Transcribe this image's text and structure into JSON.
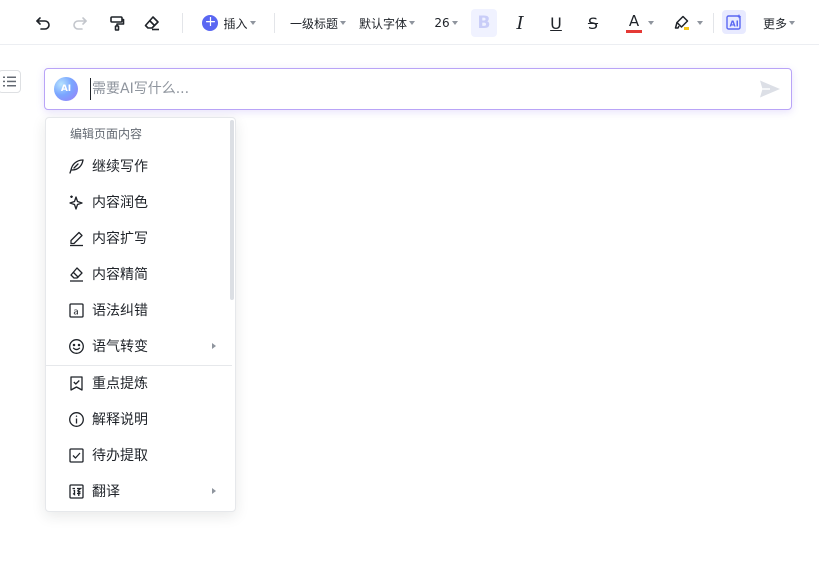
{
  "toolbar": {
    "insert_label": "插入",
    "heading_label": "一级标题",
    "font_label": "默认字体",
    "size_label": "26",
    "bold_label": "B",
    "italic_label": "I",
    "underline_label": "U",
    "strike_label": "S",
    "font_color_label": "A",
    "font_color": "#e53935",
    "more_label": "更多"
  },
  "ai_input": {
    "placeholder": "需要AI写什么...",
    "logo_text": "AI"
  },
  "menu": {
    "header": "编辑页面内容",
    "items": [
      {
        "label": "继续写作",
        "icon": "feather-pen-icon"
      },
      {
        "label": "内容润色",
        "icon": "sparkle-icon"
      },
      {
        "label": "内容扩写",
        "icon": "pencil-icon"
      },
      {
        "label": "内容精简",
        "icon": "eraser-icon"
      },
      {
        "label": "语法纠错",
        "icon": "letter-a-box-icon"
      },
      {
        "label": "语气转变",
        "icon": "smiley-icon"
      },
      {
        "label": "重点提炼",
        "icon": "bookmark-check-icon"
      },
      {
        "label": "解释说明",
        "icon": "info-circle-icon"
      },
      {
        "label": "待办提取",
        "icon": "checkbox-icon"
      },
      {
        "label": "翻译",
        "icon": "translate-box-icon"
      }
    ]
  },
  "colors": {
    "accent": "#5a67f2",
    "ai_border": "#b9a4f7"
  }
}
